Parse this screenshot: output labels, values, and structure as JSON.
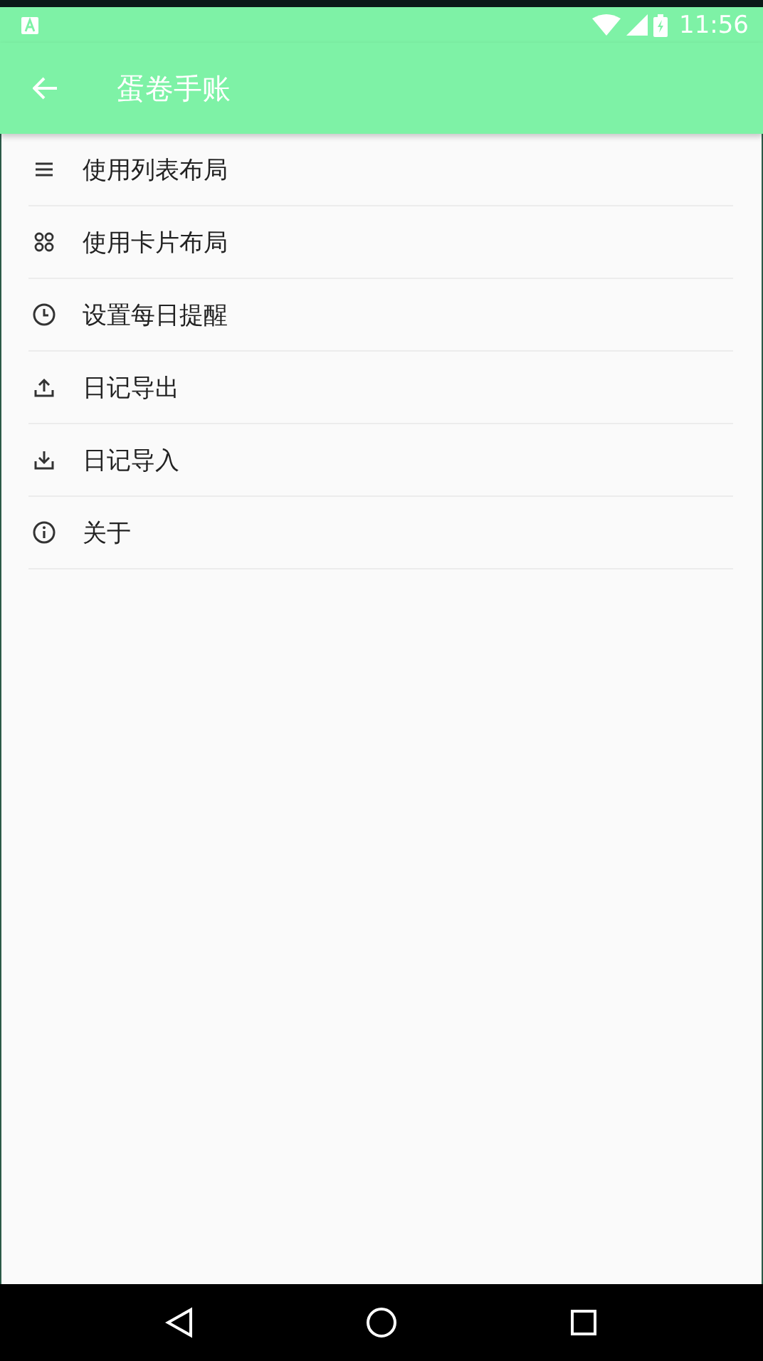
{
  "status_bar": {
    "time": "11:56"
  },
  "toolbar": {
    "title": "蛋卷手账"
  },
  "menu_items": [
    {
      "kind": "list",
      "label": "使用列表布局"
    },
    {
      "kind": "grid",
      "label": "使用卡片布局"
    },
    {
      "kind": "clock",
      "label": "设置每日提醒"
    },
    {
      "kind": "upload",
      "label": "日记导出"
    },
    {
      "kind": "download",
      "label": "日记导入"
    },
    {
      "kind": "info",
      "label": "关于"
    }
  ]
}
